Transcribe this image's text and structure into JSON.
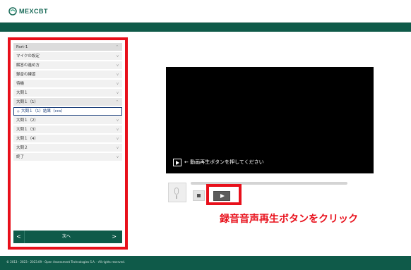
{
  "header": {
    "logo_text": "MEXCBT"
  },
  "sidebar": {
    "items": [
      {
        "label": "Part-1",
        "chevron": "^"
      },
      {
        "label": "マイクの設定",
        "chevron": "v"
      },
      {
        "label": "解答の進め方",
        "chevron": "v"
      },
      {
        "label": "録音の練習",
        "chevron": "v"
      },
      {
        "label": "待機",
        "chevron": "v"
      },
      {
        "label": "大問１",
        "chevron": "v"
      },
      {
        "label": "大問１（1）",
        "chevron": "^"
      },
      {
        "label": "大問１（1）結果（ccs）",
        "chevron": ""
      },
      {
        "label": "大問１（2）",
        "chevron": "v"
      },
      {
        "label": "大問１（3）",
        "chevron": "v"
      },
      {
        "label": "大問１（4）",
        "chevron": "v"
      },
      {
        "label": "大問２",
        "chevron": "v"
      },
      {
        "label": "終了",
        "chevron": "v"
      }
    ],
    "prev_label": "<",
    "next_label": "次へ",
    "next_arrow": ">"
  },
  "video": {
    "hint": "← 動画再生ボタンを押してください"
  },
  "annotation": "録音音声再生ボタンをクリック",
  "footer": {
    "text": "© 2013 - 2023 - 2023.09 - Open Assessment Technologies S.A. - All rights reserved."
  },
  "colors": {
    "brand": "#0f5a49",
    "highlight": "#e8101b",
    "active_border": "#1c3f7a"
  }
}
